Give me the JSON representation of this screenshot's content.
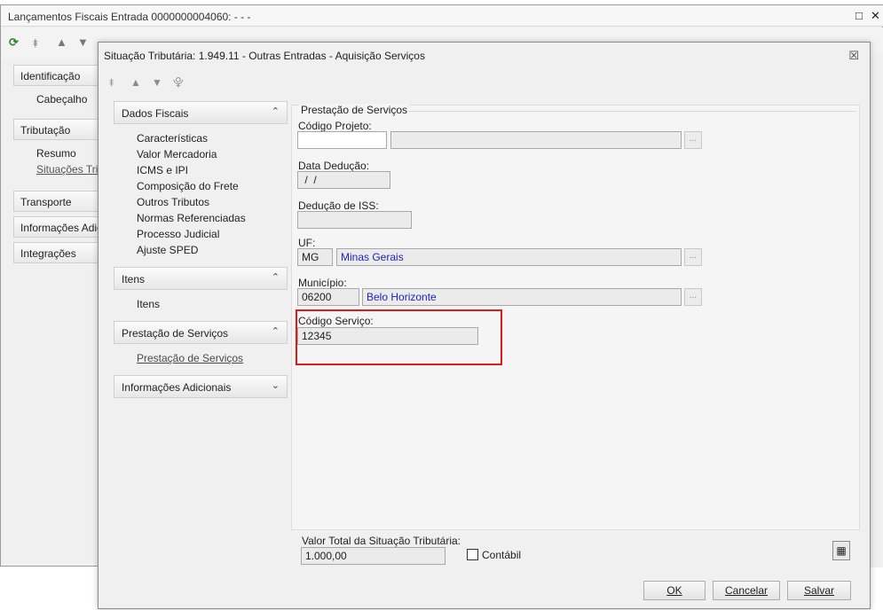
{
  "bg_window": {
    "title": "Lançamentos Fiscais Entrada 0000000004060: - - -",
    "controls": {
      "maximize": "□",
      "close": "✕"
    },
    "toolbar_icons": [
      "refresh-icon",
      "first-icon",
      "up-icon",
      "down-icon",
      "last-icon"
    ],
    "nav": {
      "groups": [
        {
          "label": "Identificação",
          "items": [
            "Cabeçalho"
          ]
        },
        {
          "label": "Tributação",
          "items": [
            "Resumo",
            "Situações Tribu"
          ]
        },
        {
          "label": "Transporte",
          "items": []
        },
        {
          "label": "Informações Adicio",
          "items": []
        },
        {
          "label": "Integrações",
          "items": []
        }
      ]
    }
  },
  "dialog": {
    "title": "Situação Tributária: 1.949.11 - Outras Entradas - Aquisição Serviços",
    "close": "☒",
    "nav_icons": [
      "⯒",
      "▲",
      "▼",
      "⯓"
    ],
    "sections": [
      {
        "label": "Dados Fiscais",
        "chevron": "⌃",
        "items": [
          "Características",
          "Valor Mercadoria",
          "ICMS e IPI",
          "Composição do Frete",
          "Outros Tributos",
          "Normas Referenciadas",
          "Processo Judicial",
          "Ajuste SPED"
        ]
      },
      {
        "label": "Itens",
        "chevron": "⌃",
        "items": [
          "Itens"
        ]
      },
      {
        "label": "Prestação de Serviços",
        "chevron": "⌃",
        "items": [
          "Prestação de Serviços"
        ]
      },
      {
        "label": "Informações Adicionais",
        "chevron": "⌄",
        "items": []
      }
    ],
    "panel": {
      "group_title": "Prestação de Serviços",
      "codigo_projeto": {
        "label": "Código Projeto:",
        "code": "",
        "desc": ""
      },
      "data_deducao": {
        "label": "Data Dedução:",
        "value": " /  /"
      },
      "deducao_iss": {
        "label": "Dedução de ISS:",
        "value": ""
      },
      "uf": {
        "label": "UF:",
        "code": "MG",
        "desc": "Minas Gerais"
      },
      "municipio": {
        "label": "Município:",
        "code": "06200",
        "desc": "Belo Horizonte"
      },
      "codigo_servico": {
        "label": "Código Serviço:",
        "value": "12345"
      },
      "ellipsis": "..."
    },
    "bottom": {
      "valor_total_label": "Valor Total da Situação Tributária:",
      "valor_total_value": "1.000,00",
      "contabil_label": "Contábil",
      "contabil_checked": false,
      "calc_icon": "calculator-icon",
      "buttons": {
        "ok": "OK",
        "cancelar": "Cancelar",
        "salvar": "Salvar"
      }
    },
    "colors": {
      "highlight": "#e01919",
      "lookup_text": "#1f1fbf"
    }
  }
}
